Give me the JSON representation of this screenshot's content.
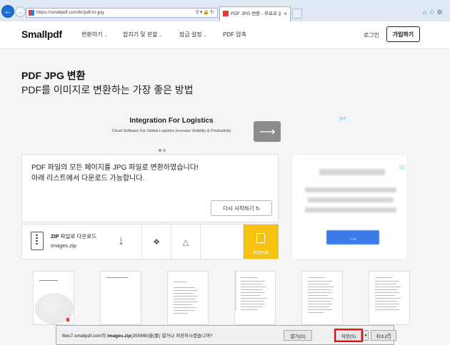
{
  "browser": {
    "url": "https://smallpdf.com/kr/pdf-to-jpg",
    "tab_title": "PDF JPG 변환 - 무료로 온..."
  },
  "site": {
    "logo": "Smallpdf",
    "nav": [
      {
        "label": "변환하기"
      },
      {
        "label": "합치기 및 분할"
      },
      {
        "label": "잠금 설정"
      },
      {
        "label": "PDF 압축"
      }
    ],
    "login": "로그인",
    "signup": "가입하기"
  },
  "page": {
    "title": "PDF JPG 변환",
    "subtitle": "PDF를 이미지로 변환하는 가장 좋은 방법"
  },
  "ad": {
    "title": "Integration For Logistics",
    "subtitle": "Cloud Software For Global Logistics Increase Visibility & Productivity"
  },
  "result": {
    "message": "PDF 파일의 모든 페이지를 JPG 파일로 변환하였습니다! 아래 리스트에서 다운로드 가능합니다.",
    "restart": "다시 시작하기",
    "zip_label": "ZIP 파일로 다운로드",
    "zip_label_prefix": "ZIP",
    "zip_label_rest": " 파일로 다운로드",
    "zip_file": "images.zip",
    "pdf_button": "PDF로"
  },
  "download_prompt": {
    "host": "files7.smallpdf.com",
    "mid": "의 ",
    "file": "images.zip",
    "size_text": "(355MB)을(를) 열거나 저장하시겠습니까?",
    "open": "열기(O)",
    "save": "저장(S)",
    "cancel": "취소(C)"
  },
  "icons": {
    "back": "back-arrow-icon",
    "forward": "forward-arrow-icon",
    "search": "search-icon",
    "lock": "lock-icon",
    "refresh": "refresh-icon",
    "home": "home-icon",
    "star": "favorites-star-icon",
    "settings": "gear-icon"
  },
  "colors": {
    "accent_yellow": "#f5c211",
    "highlight_red": "#e01010",
    "side_ad_blue": "#3b7be8"
  }
}
